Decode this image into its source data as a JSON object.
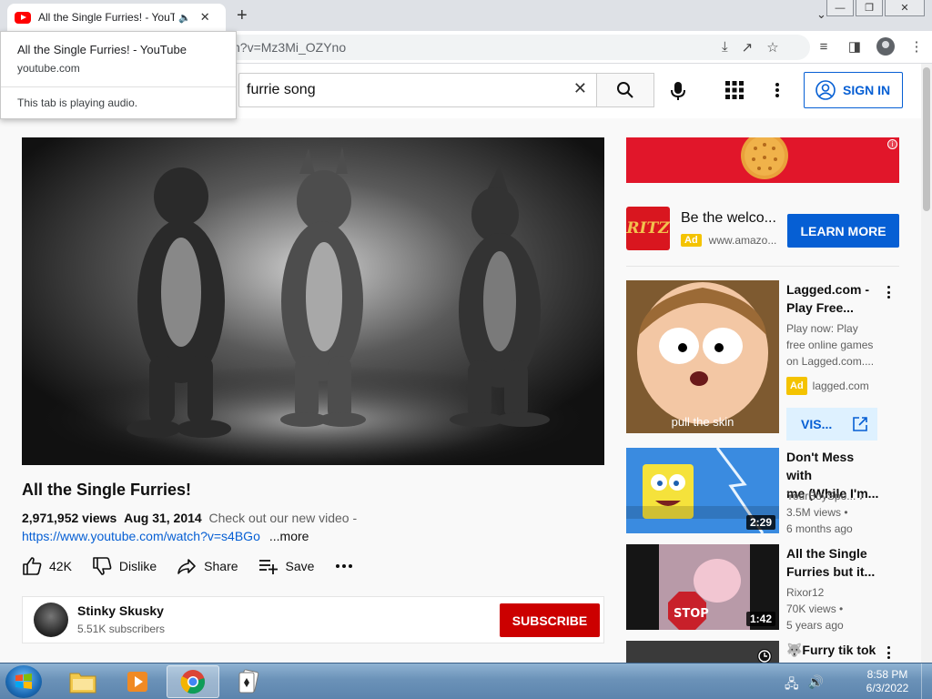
{
  "browser": {
    "tab_title": "All the Single Furries! - YouTube",
    "tab_title_truncated": "All the Single Furries! - YouTu",
    "url_visible": "h?v=Mz3Mi_OZYno",
    "tab_hover_card": {
      "title": "All the Single Furries! - YouTube",
      "domain": "youtube.com",
      "audio_status": "This tab is playing audio."
    }
  },
  "header": {
    "search_query": "furrie song",
    "signin_label": "SIGN IN"
  },
  "video": {
    "title": "All the Single Furries!",
    "views": "2,971,952 views",
    "date": "Aug 31, 2014",
    "description_snippet": "Check out our new video -",
    "description_link": "https://www.youtube.com/watch?v=s4BGo",
    "more_label": "...more",
    "actions": {
      "likes": "42K",
      "dislike": "Dislike",
      "share": "Share",
      "save": "Save"
    },
    "channel": {
      "name": "Stinky Skusky",
      "subscribers": "5.51K subscribers",
      "subscribe_label": "SUBSCRIBE"
    }
  },
  "sidebar": {
    "ad": {
      "title": "Be the welco...",
      "badge": "Ad",
      "domain": "www.amazo...",
      "cta": "LEARN MORE",
      "logo_text": "RITZ"
    },
    "recommended": [
      {
        "title_line1": "Lagged.com -",
        "title_line2": "Play Free...",
        "desc_line1": "Play now: Play",
        "desc_line2": "free online games",
        "desc_line3": "on Lagged.com....",
        "badge": "Ad",
        "domain": "lagged.com",
        "thumb_caption": "pull the skin",
        "cta": "VIS..."
      },
      {
        "title_line1": "Don't Mess with",
        "title_line2": "me (While I'm...",
        "channel": "YourBoySpo...",
        "views": "3.5M views •",
        "age": "6 months ago",
        "duration": "2:29"
      },
      {
        "title_line1": "All the Single",
        "title_line2": "Furries but it...",
        "channel": "Rixor12",
        "views": "70K views •",
        "age": "5 years ago",
        "duration": "1:42"
      },
      {
        "title_line1": "🐺Furry tik tok"
      }
    ]
  },
  "taskbar": {
    "time": "8:58 PM",
    "date": "6/3/2022"
  }
}
